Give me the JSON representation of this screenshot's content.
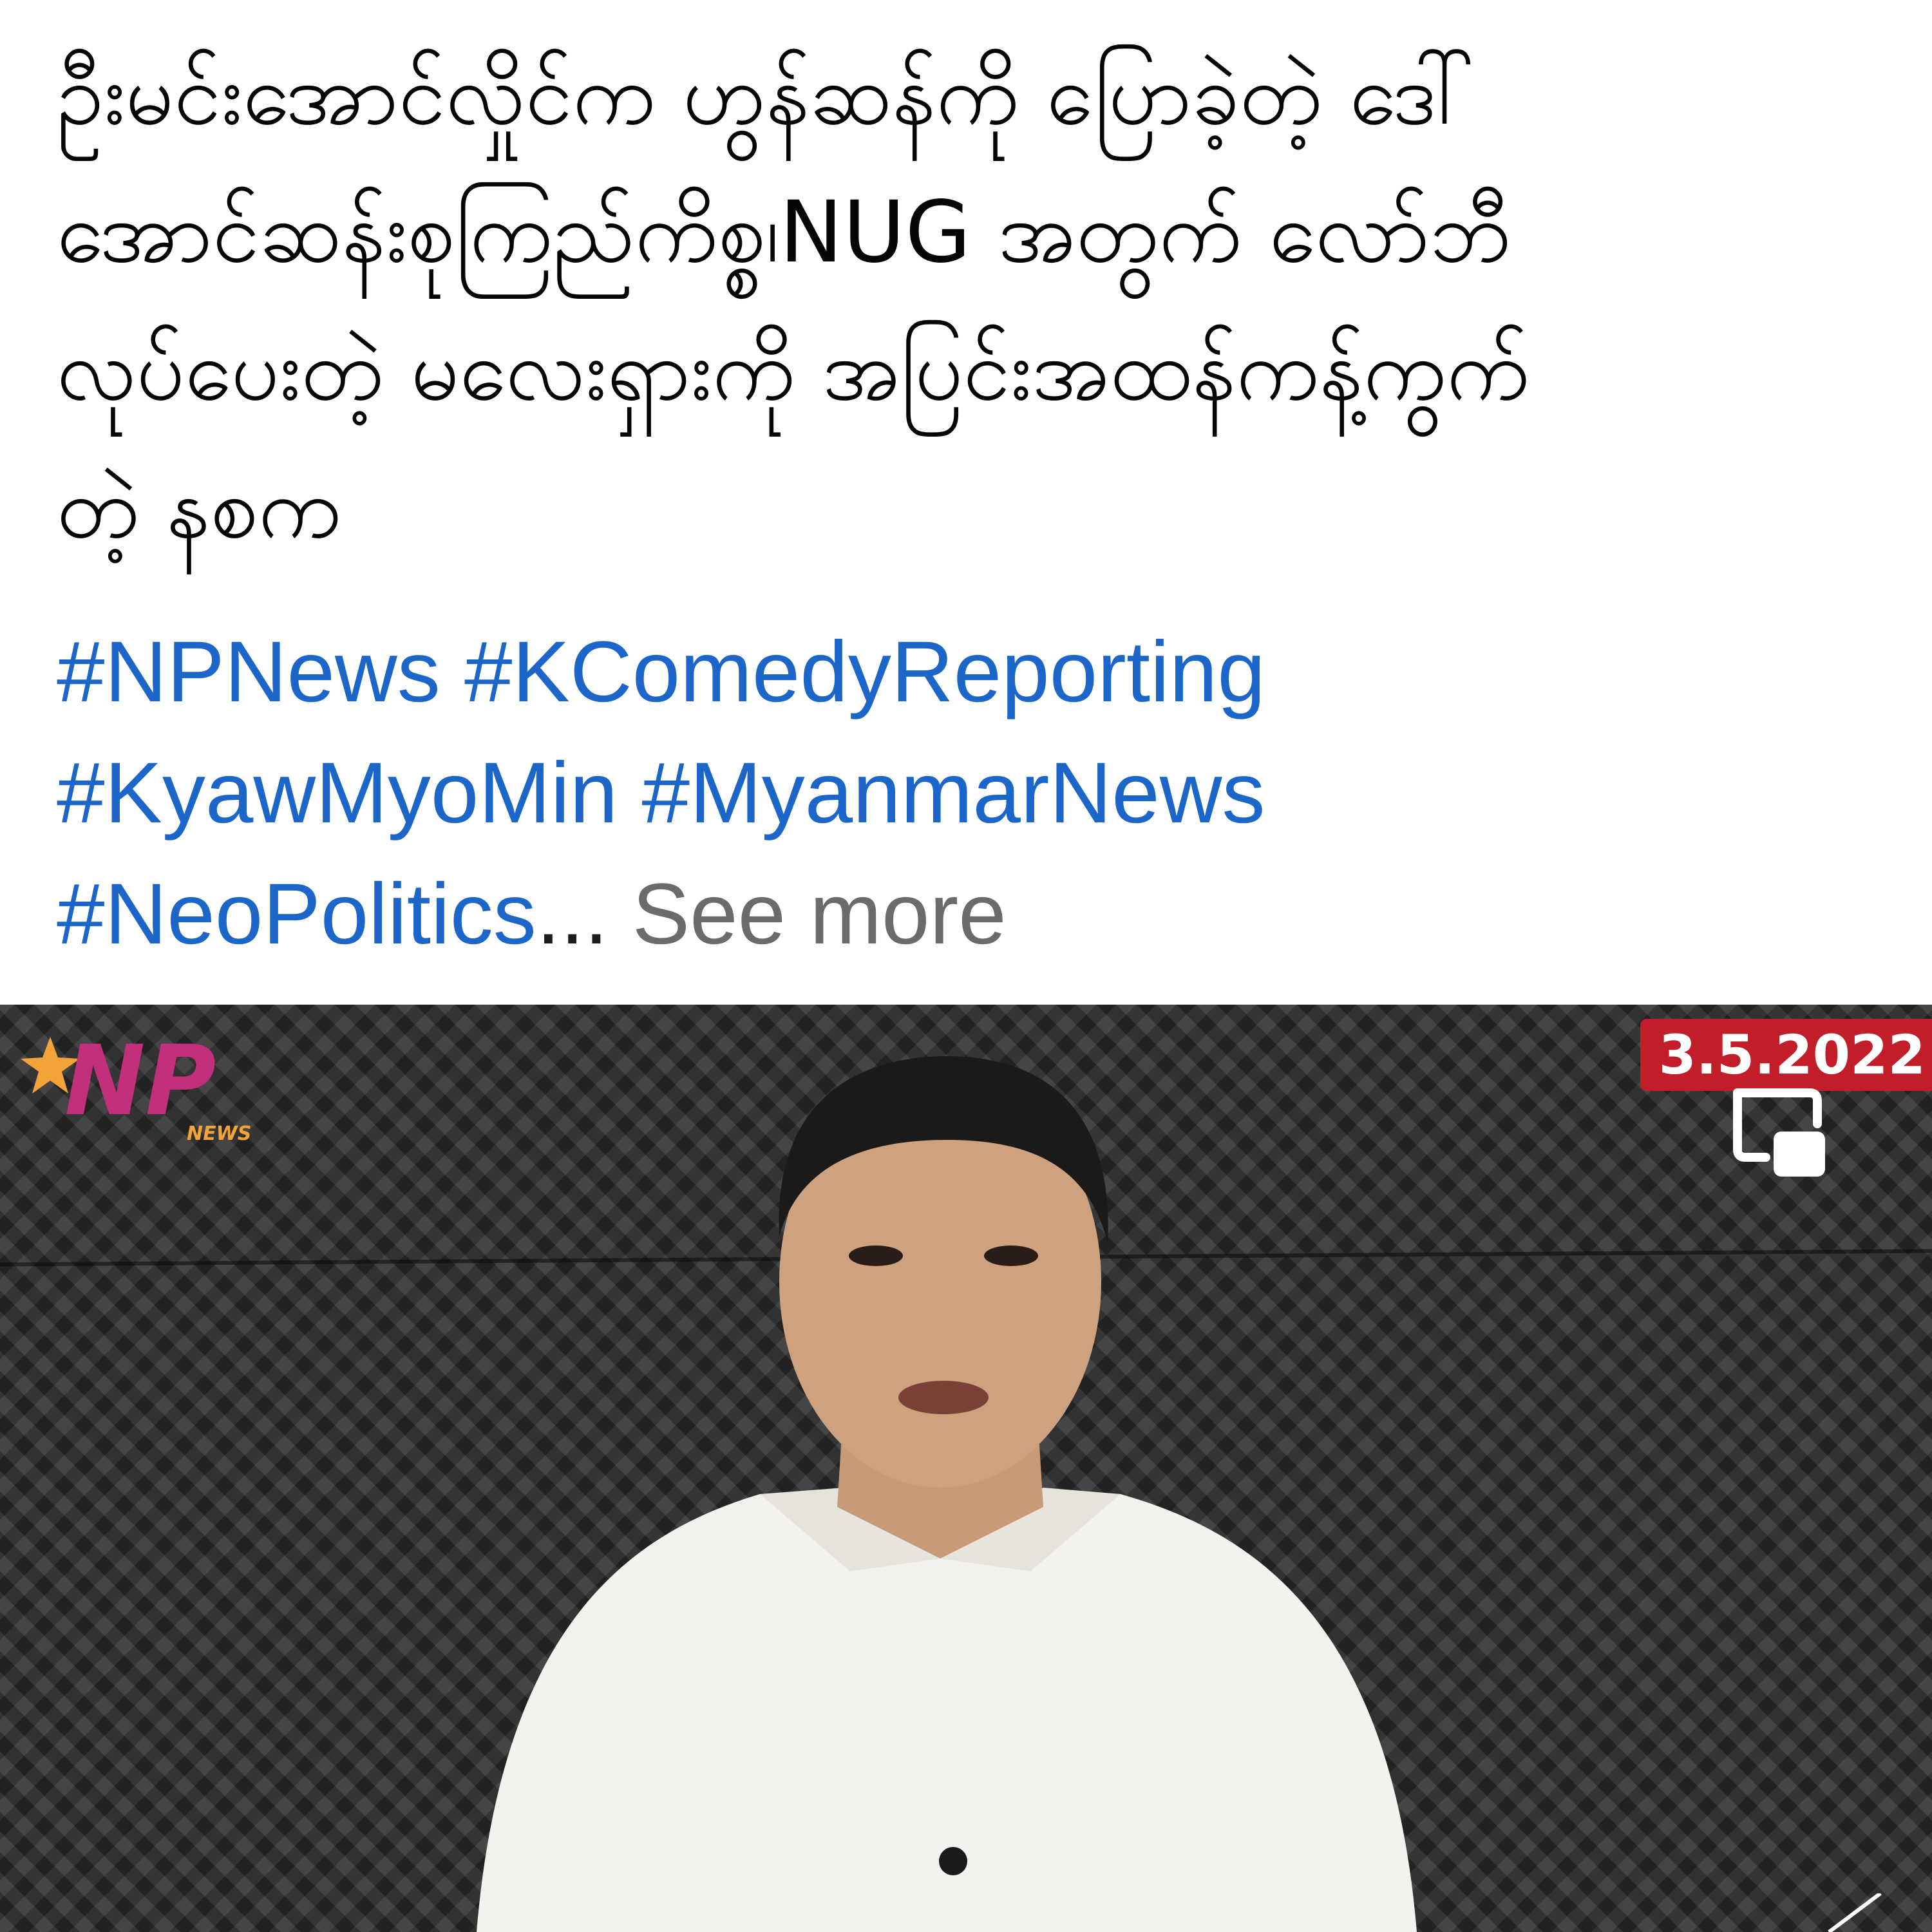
{
  "post": {
    "caption_lines": [
      "ဦးမင်းအောင်လှိုင်က ဟွန်ဆန်ကို ပြောခဲ့တဲ့ ဒေါ်",
      "အောင်ဆန်းစုကြည်ကိစ္စ၊NUG အတွက် လော်ဘီ",
      "လုပ်ပေးတဲ့ မလေးရှားကို အပြင်းအထန်ကန့်ကွက်",
      "တဲ့ နစက"
    ],
    "hashtags": [
      "#NPNews",
      "#KComedyReporting",
      "#KyawMyoMin",
      "#MyanmarNews",
      "#NeoPolitics"
    ],
    "ellipsis": "...",
    "see_more_label": "See more"
  },
  "video": {
    "date_overlay": "3.5.2022",
    "logo_text": "NP",
    "logo_subtext": "NEWS",
    "icons": {
      "pip": "picture-in-picture-icon",
      "logo": "np-news-logo"
    }
  },
  "colors": {
    "hashtag": "#1c66c9",
    "see_more": "#6b6b6b",
    "date_badge": "#c21e2a",
    "logo": "#c22f7a"
  }
}
